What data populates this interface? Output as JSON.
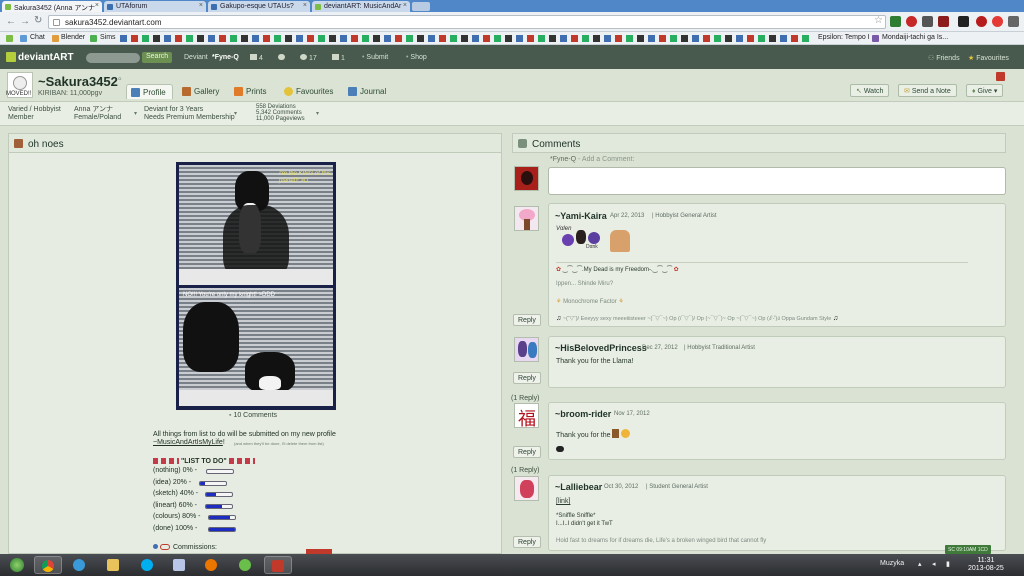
{
  "browser": {
    "tabs": [
      {
        "title": "Sakura3452 (Anna アンナ",
        "close": "×"
      },
      {
        "title": "UTAforum",
        "close": "×"
      },
      {
        "title": "Gakupo-esque UTAUs?",
        "close": "×"
      },
      {
        "title": "deviantART: MusicAndAr",
        "close": "×"
      }
    ],
    "url": "sakura3452.deviantart.com",
    "nav": {
      "back": "←",
      "forward": "→",
      "reload": "↻"
    },
    "star": "☆",
    "bookmarks": [
      {
        "label": "Chat"
      },
      {
        "label": "Blender"
      },
      {
        "label": "Sims"
      },
      {
        "label": "Epsilon: Tempo I"
      },
      {
        "label": "Mondaiji-tachi ga Is..."
      }
    ]
  },
  "da_bar": {
    "logo": "deviantART",
    "search_button": "Search",
    "deviant_prefix": "Deviant",
    "deviant_name": "*Fyne-Q",
    "notif_1": "4",
    "notif_2": "17",
    "notif_3": "1",
    "submit": "Submit",
    "shop": "Shop",
    "friends": "Friends",
    "favourites": "Favourites"
  },
  "profile": {
    "moved_label": "MOVED!!",
    "username": "~Sakura3452",
    "kiriban": "KIRIBAN: 11,000pgv",
    "tabs": [
      "Profile",
      "Gallery",
      "Prints",
      "Favourites",
      "Journal"
    ],
    "actions": {
      "watch": "Watch",
      "note": "Send a Note",
      "give": "Give ▾"
    },
    "info": {
      "type_line1": "Varied / Hobbyist",
      "type_line2": "Member",
      "name_line1": "Anna アンナ",
      "name_line2": "Female/Poland",
      "deviant_line1": "Deviant for 3 Years",
      "deviant_line2": "Needs Premium Membership",
      "deviations": "558 Deviations",
      "comments": "5,342 Comments",
      "pageviews": "11,000 Pageviews"
    }
  },
  "left_panel": {
    "title": "oh noes",
    "caption_top": "I'm the KING of this planet!! >D",
    "caption_bottom": "NO!!! You're only my knight! >DDD",
    "comments_count": "10 Comments",
    "desc_line1": "All things from list to do will be submitted on my new profile",
    "desc_link": "~MusicAndArtIsMyLife",
    "desc_small": "(and when they'll be done, I'll delete them from list)",
    "list_title": "\"LIST TO DO\"",
    "progress": [
      {
        "label": "(nothing) 0% -",
        "value": 0
      },
      {
        "label": "(idea) 20% -",
        "value": 20
      },
      {
        "label": "(sketch) 40% -",
        "value": 40
      },
      {
        "label": "(lineart) 60% -",
        "value": 60
      },
      {
        "label": "(colours) 80% -",
        "value": 80
      },
      {
        "label": "(done) 100% -",
        "value": 100
      }
    ],
    "commissions": "Commissions:"
  },
  "comments_panel": {
    "title": "Comments",
    "add_prompt_user": "*Fyne-Q",
    "add_prompt_text": " - Add a Comment:",
    "reply_label": "Reply",
    "items": [
      {
        "user": "~Yami-Kaira",
        "date": "Apr 22, 2013",
        "role": "Hobbyist General Artist",
        "lines": [
          "‿⁀‿⁀.My Dead is my Freedom-.‿⁀‿⁀",
          "Ippen... Shinde Miru?",
          "Monochrome Factor",
          "~(˘▽˘)/ Eeeyyy sexy meeeiiisteeer ~(¯▽¯~) Op (/¯▽¯)/ Op (~¯▽¯)~ Op ~(¯▽¯~) Op (ง'̀-'́)ง Oppa Gundam Style"
        ]
      },
      {
        "user": "~HisBelovedPrincess",
        "date": "Dec 27, 2012",
        "role": "Hobbyist Traditional Artist",
        "lines": [
          "Thank you for the Llama!"
        ]
      },
      {
        "user": "~broom-rider",
        "date": "Nov 17, 2012",
        "role": "",
        "replies": "(1 Reply)",
        "lines": [
          "Thank you for the"
        ]
      },
      {
        "user": "~Lalliebear",
        "date": "Oct 30, 2012",
        "role": "Student General Artist",
        "replies": "(1 Reply)",
        "lines": [
          "[link]",
          "*Sniffle Sniffle*",
          "I...I..I didn't get it TwT",
          "Hold fast to dreams for if dreams die, Life's a broken winged bird that cannot fly"
        ]
      }
    ]
  },
  "taskbar": {
    "tray_lang": "Muzyka",
    "time": "11:31",
    "date": "2013-08-25",
    "sc_badge": "SC 09:10AM 1CD"
  },
  "colors": {
    "da_bar": "#475a4d",
    "accent_green": "#b5cf3c",
    "progress_fill": "#1d2dbf",
    "page_bg": "#d9e2d3"
  }
}
